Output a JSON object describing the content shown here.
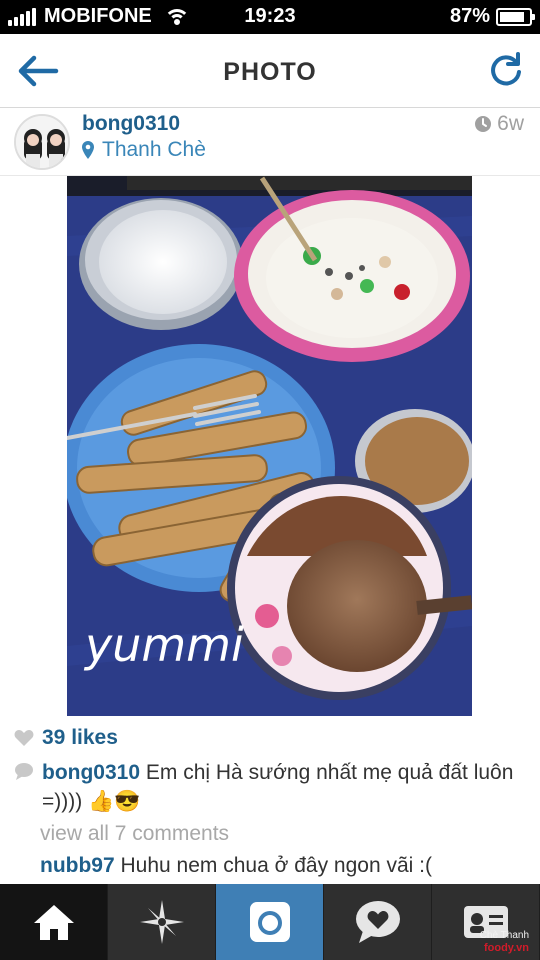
{
  "status_bar": {
    "carrier": "MOBIFONE",
    "time": "19:23",
    "battery_percent": "87%",
    "battery_level": 0.87
  },
  "header": {
    "title": "PHOTO",
    "back_icon": "arrow-left-icon",
    "refresh_icon": "refresh-icon"
  },
  "post": {
    "username": "bong0310",
    "location": "Thanh Chè",
    "time_ago": "6w",
    "photo_caption_overlay": "yummi",
    "likes": "39 likes",
    "caption_user": "bong0310",
    "caption_text": "Em chị Hà sướng nhất mẹ quả đất luôn =)))) 👍😎",
    "view_all": "view all 7 comments",
    "comment_user": "nubb97",
    "comment_text": "Huhu nem chua ở đây ngon vãi :("
  },
  "tabbar": {
    "items": [
      {
        "icon": "home-icon",
        "active": false
      },
      {
        "icon": "explore-star-icon",
        "active": false
      },
      {
        "icon": "camera-icon",
        "active": true
      },
      {
        "icon": "activity-heart-icon",
        "active": false
      },
      {
        "icon": "profile-card-icon",
        "active": false
      }
    ]
  },
  "watermark": {
    "line1": "Chè Thanh",
    "line2": "foody.vn"
  },
  "colors": {
    "link": "#1f5f8b",
    "accent": "#3f7fb5",
    "tabbar": "#2f2f2f"
  }
}
